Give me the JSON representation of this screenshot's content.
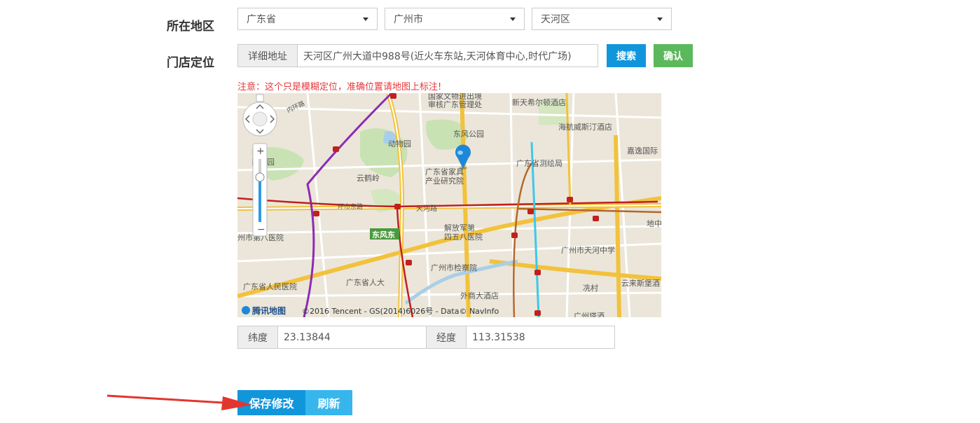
{
  "region": {
    "label": "所在地区",
    "province": "广东省",
    "city": "广州市",
    "district": "天河区"
  },
  "location": {
    "label": "门店定位",
    "address_addon": "详细地址",
    "address_value": "天河区广州大道中988号(近火车东站,天河体育中心,时代广场)",
    "search_button": "搜索",
    "confirm_button": "确认",
    "note": "注意：这个只是模糊定位，准确位置请地图上标注!"
  },
  "map": {
    "copyright": "©2016 Tencent - GS(2014)6026号 - Data© NavInfo",
    "logo": "腾讯地图",
    "places": [
      "国家文物进出境",
      "审核广东管理处",
      "新天希尔顿酒店",
      "内环路",
      "东风公园",
      "海航威斯汀酒店",
      "动物园",
      "嘉逸国际",
      "岗公园",
      "广东省测绘局",
      "广东省家具",
      "产业研究院",
      "云鹤岭",
      "环市东路",
      "天河路",
      "地中",
      "东风东",
      "解放军第",
      "四五八医院",
      "州市第八医院",
      "广州市天河中学",
      "广州市检察院",
      "广东省人大",
      "广东省人民医院",
      "冼村",
      "云来斯堡酒",
      "外商大酒店",
      "广州塔酒"
    ],
    "colors": {
      "metro_purple": "#8e2ab5",
      "metro_red": "#c0201e",
      "metro_cyan": "#3ec7ee",
      "metro_brown": "#b5662a",
      "major_road": "#f2c23c",
      "marker": "#1e88d8"
    }
  },
  "coords": {
    "lat_label": "纬度",
    "lat_value": "23.13844",
    "lng_label": "经度",
    "lng_value": "113.31538"
  },
  "actions": {
    "save_label": "保存修改",
    "refresh_label": "刷新",
    "colors": {
      "save": "#1296db",
      "refresh": "#37b6ed",
      "search": "#1296db",
      "confirm": "#5cb85c",
      "arrow": "#e3362e"
    }
  }
}
